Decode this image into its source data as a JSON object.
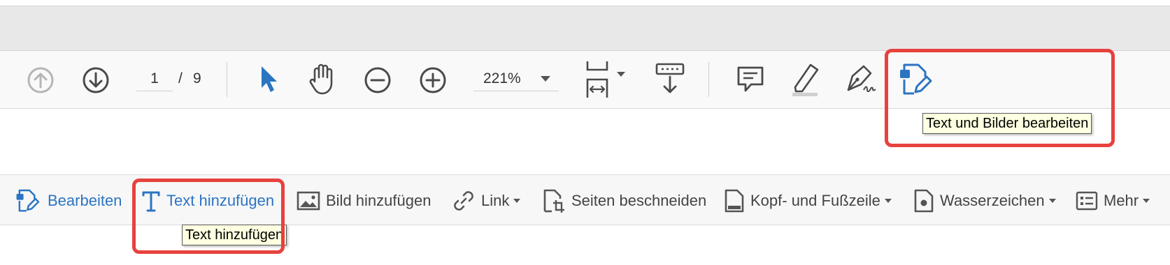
{
  "toolbar": {
    "page_current": "1",
    "page_separator": "/",
    "page_total": "9",
    "zoom_value": "221%"
  },
  "tooltips": {
    "edit_text_images": "Text und Bilder bearbeiten",
    "add_text": "Text hinzufügen"
  },
  "edit_toolbar": {
    "items": [
      {
        "label": "Bearbeiten"
      },
      {
        "label": "Text hinzufügen"
      },
      {
        "label": "Bild hinzufügen"
      },
      {
        "label": "Link"
      },
      {
        "label": "Seiten beschneiden"
      },
      {
        "label": "Kopf- und Fußzeile"
      },
      {
        "label": "Wasserzeichen"
      },
      {
        "label": "Mehr"
      }
    ]
  },
  "colors": {
    "accent_blue": "#2b74c2",
    "highlight_red": "#e8413e",
    "tooltip_bg": "#ffffe1"
  }
}
